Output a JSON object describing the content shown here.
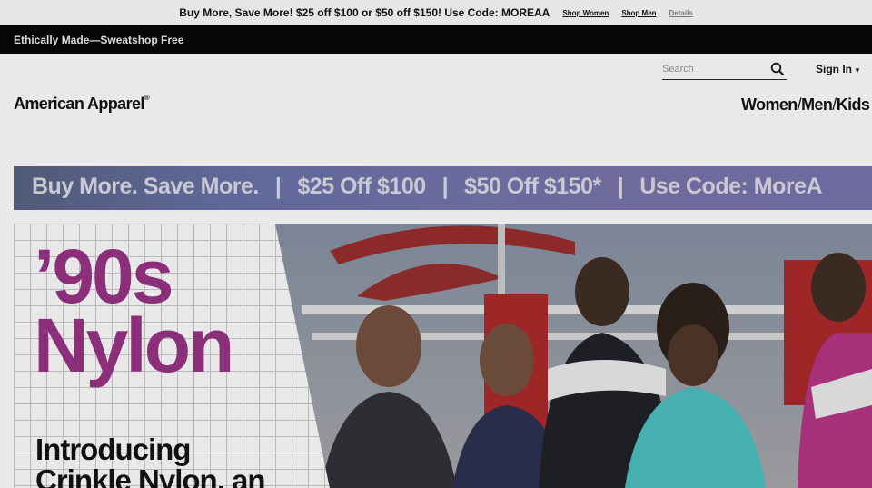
{
  "promo": {
    "text": "Buy More, Save More! $25 off $100 or $50 off $150! Use Code: MOREAA",
    "shop_women": "Shop Women",
    "shop_men": "Shop Men",
    "details": "Details"
  },
  "tagline": "Ethically Made—Sweatshop Free",
  "header": {
    "search_placeholder": "Search",
    "sign_in": "Sign In",
    "logo": "American Apparel",
    "logo_mark": "®",
    "nav": {
      "women": "Women",
      "sep": "/",
      "men": "Men",
      "kids": "Kids"
    }
  },
  "banner": {
    "part1": "Buy More. Save More.",
    "part2": "$25 Off $100",
    "part3": "$50 Off $150*",
    "part4": "Use Code: MoreA",
    "pipe": "|"
  },
  "hero": {
    "title_line1": "’90s",
    "title_line2": "Nylon",
    "sub_line1": "Introducing",
    "sub_line2": "Crinkle Nylon, an"
  },
  "icons": {
    "search": "search-icon",
    "caret": "caret-down-icon"
  },
  "colors": {
    "promo_bg": "#e6e6e6",
    "tagline_bg": "#060606",
    "hero_title": "#8c2f7a",
    "banner": "#60689a"
  }
}
